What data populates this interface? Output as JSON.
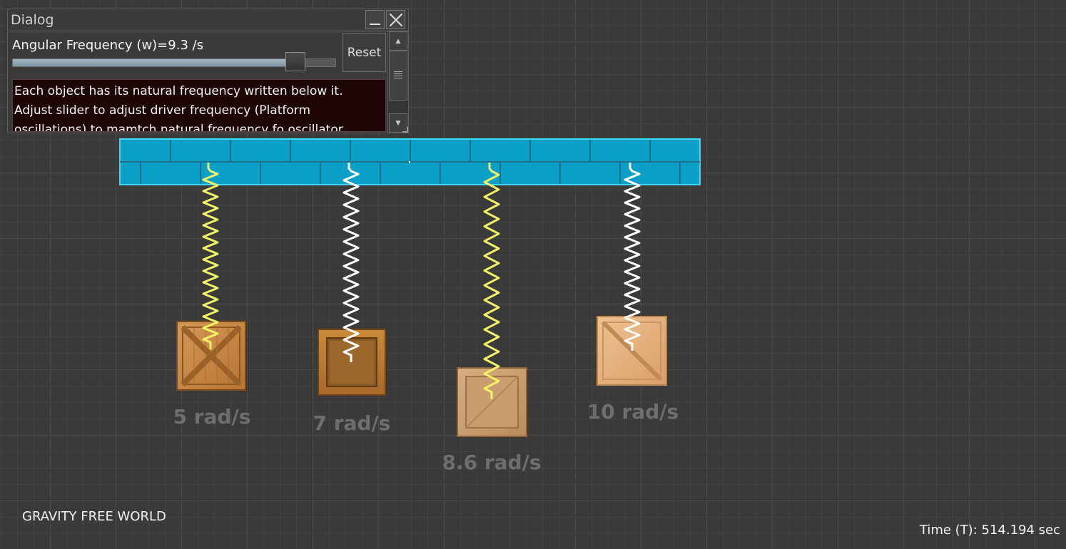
{
  "dialog": {
    "title": "Dialog",
    "frequency_label": "Angular Frequency (w)=9.3 /s",
    "slider_fraction": 0.93,
    "reset_label": "Reset",
    "description": "Each object has its natural frequency written below it. Adjust slider to adjust driver frequency (Platform oscillations) to mamtch natural frequency fo oscillator"
  },
  "oscillators": [
    {
      "label": "5 rad/s",
      "spring_color": "#f2f266",
      "crate_style": "x-brace"
    },
    {
      "label": "7 rad/s",
      "spring_color": "#ffffff",
      "crate_style": "box"
    },
    {
      "label": "8.6 rad/s",
      "spring_color": "#f2f266",
      "crate_style": "plank"
    },
    {
      "label": "10 rad/s",
      "spring_color": "#ffffff",
      "crate_style": "diagonal"
    }
  ],
  "platform": {
    "color": "#0aa0c8"
  },
  "world_label": "GRAVITY FREE WORLD",
  "time_label": "Time (T): 514.194 sec"
}
